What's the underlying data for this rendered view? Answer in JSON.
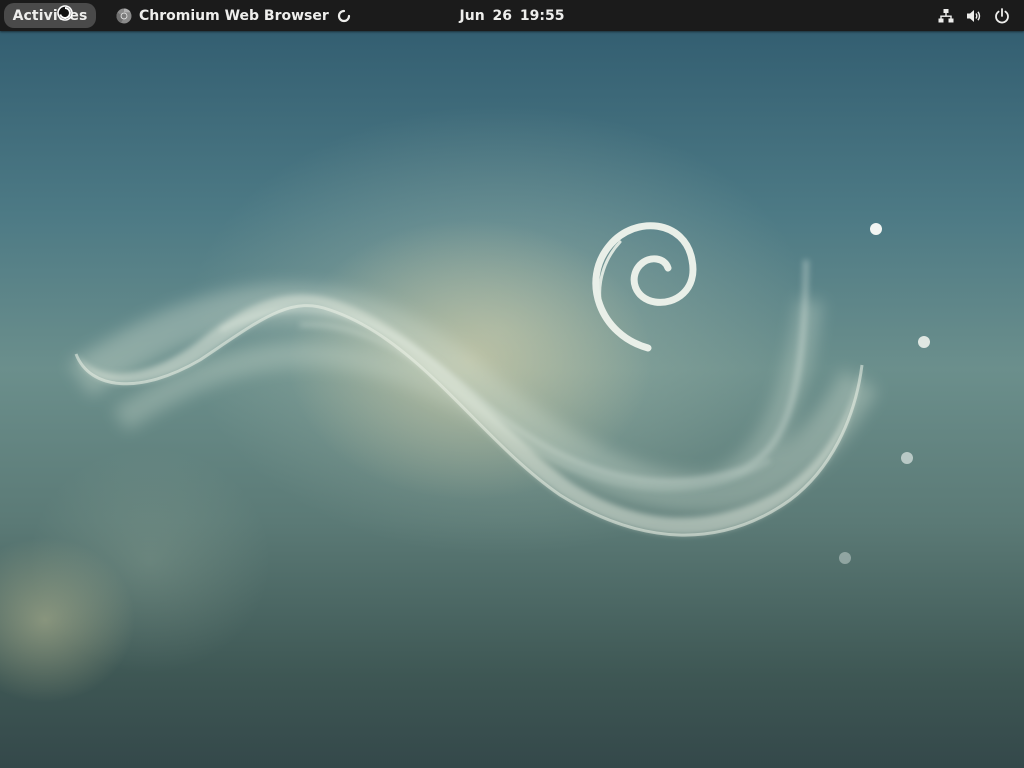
{
  "topbar": {
    "activities_label": "Activities",
    "app_menu_label": "Chromium Web Browser",
    "clock_text": "Jun 26  19:55"
  },
  "icons": {
    "app": "chromium-icon",
    "loading": "spinner-icon",
    "cursor": "mouse-cursor-busy-icon",
    "network": "network-wired-icon",
    "volume": "volume-icon",
    "power": "power-icon"
  },
  "colors": {
    "topbar_bg": "#1b1b1b",
    "topbar_text": "#eeeeec",
    "activities_bg": "#4a4a4a",
    "wallpaper_top": "#2f5a6e",
    "wallpaper_bottom": "#34484a",
    "swirl": "#e9efe8"
  },
  "desktop": {
    "wallpaper": "debian-9-softwaves-swirl"
  }
}
